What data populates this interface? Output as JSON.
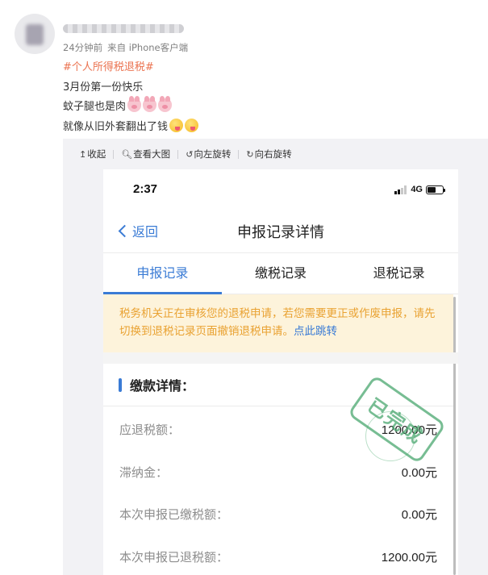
{
  "post": {
    "meta_time": "24分钟前",
    "meta_source": "来自 iPhone客户端",
    "hashtag": "#个人所得税退税#",
    "line1": "3月份第一份快乐",
    "line2": "蚊子腿也是肉",
    "line3": "就像从旧外套翻出了钱",
    "line2_emojis": [
      "pig-face-icon",
      "pig-face-icon",
      "pig-face-icon"
    ],
    "line3_emojis": [
      "yum-face-icon",
      "yum-face-icon"
    ]
  },
  "toolbar": {
    "collapse": "收起",
    "view_large": "查看大图",
    "rotate_left": "向左旋转",
    "rotate_right": "向右旋转"
  },
  "phone": {
    "status": {
      "time": "2:37",
      "network": "4G"
    },
    "nav": {
      "back": "返回",
      "title": "申报记录详情"
    },
    "tabs": [
      {
        "label": "申报记录",
        "active": true
      },
      {
        "label": "缴税记录",
        "active": false
      },
      {
        "label": "退税记录",
        "active": false
      }
    ],
    "notice": {
      "text": "税务机关正在审核您的退税申请，若您需要更正或作废申报，请先切换到退税记录页面撤销退税申请。",
      "link": "点此跳转"
    },
    "section_title": "缴款详情：",
    "stamp_text": "已完成",
    "rows": [
      {
        "label": "应退税额：",
        "value": "1200.00元"
      },
      {
        "label": "滞纳金：",
        "value": "0.00元"
      },
      {
        "label": "本次申报已缴税额：",
        "value": "0.00元"
      },
      {
        "label": "本次申报已退税额：",
        "value": "1200.00元"
      }
    ]
  },
  "colors": {
    "accent_blue": "#3a7bd5",
    "hashtag_orange": "#eb7350",
    "notice_bg": "#fdf3db",
    "notice_text": "#e9a232",
    "stamp_green": "#4aa76f"
  }
}
